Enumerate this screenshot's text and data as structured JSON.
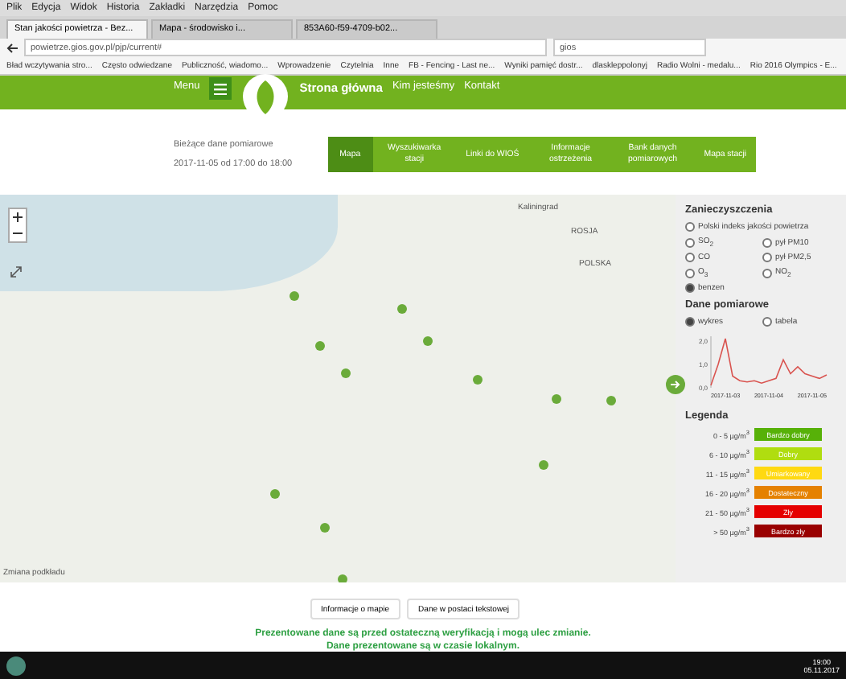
{
  "browser": {
    "menu": [
      "Plik",
      "Edycja",
      "Widok",
      "Historia",
      "Zakładki",
      "Narzędzia",
      "Pomoc"
    ],
    "tabs": [
      {
        "label": "Stan jakości powietrza - Bez...",
        "selected": true
      },
      {
        "label": "Mapa - środowisko i...",
        "selected": false
      },
      {
        "label": "853A60-f59-4709-b02...",
        "selected": false
      }
    ],
    "url": "powietrze.gios.gov.pl/pjp/current#",
    "search": "gios",
    "bookmarks": [
      "Bład wczytywania stro...",
      "Często odwiedzane",
      "Publiczność, wiadomo...",
      "Wprowadzenie",
      "Czytelnia",
      "Inne",
      "FB - Fencing - Last ne...",
      "Wyniki pamięć dostr...",
      "dlaskleppolonyj",
      "Radio Wolni - medalu...",
      "Rio 2016 Olympics - E..."
    ]
  },
  "header": {
    "menu": "Menu",
    "links": [
      "Strona główna",
      "Kim jesteśmy",
      "Kontakt"
    ]
  },
  "info": {
    "title": "Bieżące dane pomiarowe",
    "date": "2017-11-05 od 17:00 do 18:00"
  },
  "nav": [
    {
      "label": "Mapa",
      "selected": true
    },
    {
      "label": "Wyszukiwarka stacji",
      "selected": false
    },
    {
      "label": "Linki do WIOŚ",
      "selected": false
    },
    {
      "label": "Informacje ostrzeżenia",
      "selected": false
    },
    {
      "label": "Bank danych pomiarowych",
      "selected": false
    },
    {
      "label": "Mapa stacji",
      "selected": false
    }
  ],
  "map": {
    "labels": [
      "Kaliningrad",
      "ROSJA",
      "POLSKA"
    ],
    "base_layer": "Zmiana podkładu",
    "markers": [
      {
        "color": "#6aab3a"
      },
      {
        "color": "#6aab3a"
      },
      {
        "color": "#6aab3a"
      },
      {
        "color": "#6aab3a"
      },
      {
        "color": "#6aab3a"
      },
      {
        "color": "#6aab3a"
      },
      {
        "color": "#6aab3a"
      },
      {
        "color": "#6aab3a"
      },
      {
        "color": "#6aab3a"
      },
      {
        "color": "#6aab3a"
      },
      {
        "color": "#6aab3a"
      },
      {
        "color": "#6aab3a"
      }
    ]
  },
  "panel": {
    "pollutants_title": "Zanieczyszczenia",
    "pollutants": [
      {
        "label": "Polski indeks jakości powietrza",
        "selected": false
      },
      {
        "label": "SO$_{2}$",
        "selected": false
      },
      {
        "label": "pył PM10",
        "selected": false
      },
      {
        "label": "CO",
        "selected": false
      },
      {
        "label": "pył PM2,5",
        "selected": false
      },
      {
        "label": "O$_{3}$",
        "selected": false
      },
      {
        "label": "NO$_{2}$",
        "selected": false
      },
      {
        "label": "benzen",
        "selected": true
      }
    ],
    "data_title": "Dane pomiarowe",
    "views": [
      {
        "label": "wykres",
        "selected": true
      },
      {
        "label": "tabela",
        "selected": false
      }
    ],
    "chart": {
      "x_labels": [
        "2017-11-03",
        "2017-11-04",
        "2017-11-05"
      ],
      "y_labels": [
        "2,0",
        "1,0",
        "0,0"
      ]
    },
    "legend_title": "Legenda",
    "legend": [
      {
        "range": "0 - 5 µg/m$^{3}$",
        "label": "Bardzo dobry",
        "color": "#57b108"
      },
      {
        "range": "6 - 10 µg/m$^{3}$",
        "label": "Dobry",
        "color": "#b0dd10"
      },
      {
        "range": "11 - 15 µg/m$^{3}$",
        "label": "Umiarkowany",
        "color": "#ffd911"
      },
      {
        "range": "16 - 20 µg/m$^{3}$",
        "label": "Dostateczny",
        "color": "#e58100"
      },
      {
        "range": "21 - 50 µg/m$^{3}$",
        "label": "Zły",
        "color": "#e50000"
      },
      {
        "range": "> 50 µg/m$^{3}$",
        "label": "Bardzo zły",
        "color": "#990000"
      }
    ]
  },
  "buttons": [
    "Informacje o mapie",
    "Dane w postaci tekstowej"
  ],
  "notice": [
    "Prezentowane dane są przed ostateczną weryfikacją i mogą ulec zmianie.",
    "Dane prezentowane są w czasie lokalnym."
  ],
  "taskbar": {
    "time": "19:00",
    "date": "05.11.2017"
  }
}
